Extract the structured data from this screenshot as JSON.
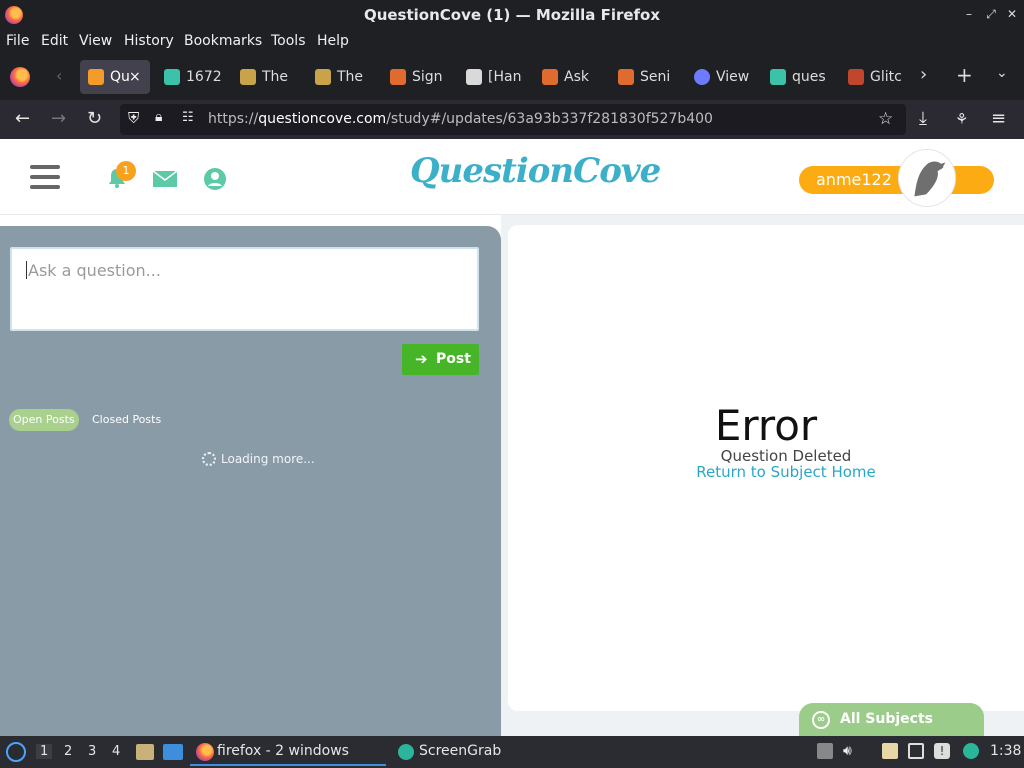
{
  "window": {
    "title": "QuestionCove (1) — Mozilla Firefox"
  },
  "menu": [
    "File",
    "Edit",
    "View",
    "History",
    "Bookmarks",
    "Tools",
    "Help"
  ],
  "tabs": [
    {
      "label": "Qu",
      "active": true
    },
    {
      "label": "1672"
    },
    {
      "label": "The"
    },
    {
      "label": "The"
    },
    {
      "label": "Sign"
    },
    {
      "label": "[Han"
    },
    {
      "label": "Ask"
    },
    {
      "label": "Seni"
    },
    {
      "label": "View"
    },
    {
      "label": "ques"
    },
    {
      "label": "Glitc"
    }
  ],
  "tab_close": "×",
  "address": {
    "prefix": "https://",
    "host": "questioncove.com",
    "path": "/study#/updates/63a93b337f281830f527b400"
  },
  "site": {
    "logo": "QuestionCove",
    "notification_count": "1",
    "username": "anme122"
  },
  "ask": {
    "placeholder": "Ask a question...",
    "post_label": "Post"
  },
  "filters": {
    "open": "Open Posts",
    "closed": "Closed Posts"
  },
  "loading": "Loading more...",
  "error": {
    "title": "Error",
    "message": "Question Deleted",
    "link": "Return to Subject Home"
  },
  "all_subjects": "All Subjects",
  "taskbar": {
    "workspaces": [
      "1",
      "2",
      "3",
      "4"
    ],
    "firefox": "firefox - 2 windows",
    "screengrab": "ScreenGrab",
    "clock": "1:38"
  },
  "colors": {
    "brand": "#3cb0c9",
    "user_pill": "#fcab13",
    "post": "#47b528",
    "left_pane": "#8a9ba8"
  }
}
